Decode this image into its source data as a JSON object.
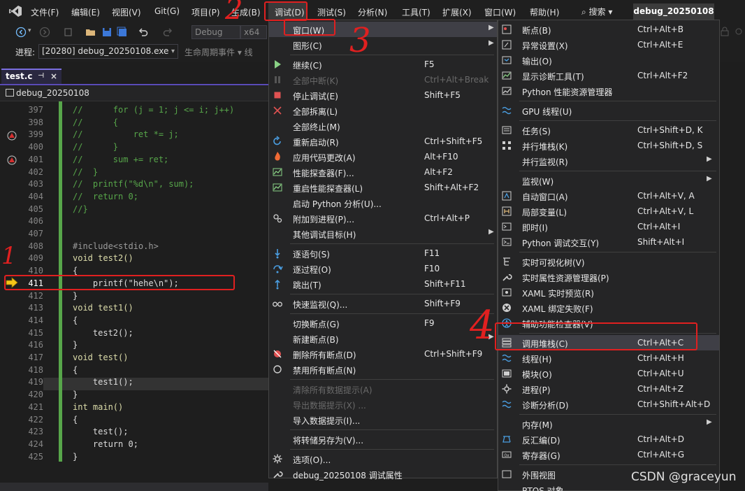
{
  "menubar": {
    "items": [
      "文件(F)",
      "编辑(E)",
      "视图(V)",
      "Git(G)",
      "项目(P)",
      "生成(B)",
      "调试(D)",
      "测试(S)",
      "分析(N)",
      "工具(T)",
      "扩展(X)",
      "窗口(W)",
      "帮助(H)"
    ],
    "search": "搜索",
    "solution": "debug_20250108"
  },
  "toolbar": {
    "config": "Debug",
    "platform": "x64",
    "process_label": "进程:",
    "process_value": "[20280] debug_20250108.exe",
    "lifecycle": "生命周期事件 ▾ 线"
  },
  "editor": {
    "tab_label": "test.c",
    "navbar_label": "debug_20250108",
    "lines": [
      {
        "n": "397",
        "t": "//      for (j = 1; j <= i; j++)",
        "c": "comment"
      },
      {
        "n": "398",
        "t": "//      {",
        "c": "comment"
      },
      {
        "n": "399",
        "t": "//          ret *= j;",
        "c": "comment"
      },
      {
        "n": "400",
        "t": "//      }",
        "c": "comment"
      },
      {
        "n": "401",
        "t": "//      sum += ret;",
        "c": "comment"
      },
      {
        "n": "402",
        "t": "//  }",
        "c": "comment"
      },
      {
        "n": "403",
        "t": "//  printf(\"%d\\n\", sum);",
        "c": "comment"
      },
      {
        "n": "404",
        "t": "//  return 0;",
        "c": "comment"
      },
      {
        "n": "405",
        "t": "//}",
        "c": "comment"
      },
      {
        "n": "406",
        "t": "",
        "c": "plain"
      },
      {
        "n": "407",
        "t": "",
        "c": "plain"
      },
      {
        "n": "408",
        "t": "#include<stdio.h>",
        "c": "pp"
      },
      {
        "n": "409",
        "t": "void test2()",
        "c": "decl"
      },
      {
        "n": "410",
        "t": "{",
        "c": "plain"
      },
      {
        "n": "411",
        "t": "    printf(\"hehe\\n\");",
        "c": "plain"
      },
      {
        "n": "412",
        "t": "}",
        "c": "plain"
      },
      {
        "n": "413",
        "t": "void test1()",
        "c": "decl"
      },
      {
        "n": "414",
        "t": "{",
        "c": "plain"
      },
      {
        "n": "415",
        "t": "    test2();",
        "c": "plain"
      },
      {
        "n": "416",
        "t": "}",
        "c": "plain"
      },
      {
        "n": "417",
        "t": "void test()",
        "c": "decl"
      },
      {
        "n": "418",
        "t": "{",
        "c": "plain"
      },
      {
        "n": "419",
        "t": "    test1();",
        "c": "plain"
      },
      {
        "n": "420",
        "t": "}",
        "c": "plain"
      },
      {
        "n": "421",
        "t": "int main()",
        "c": "decl"
      },
      {
        "n": "422",
        "t": "{",
        "c": "plain"
      },
      {
        "n": "423",
        "t": "    test();",
        "c": "plain"
      },
      {
        "n": "424",
        "t": "    return 0;",
        "c": "plain"
      },
      {
        "n": "425",
        "t": "}",
        "c": "plain"
      }
    ],
    "current_line": "411"
  },
  "debug_menu": {
    "items": [
      {
        "label": "窗口(W)",
        "shortcut": "",
        "icon": "",
        "submenu": true,
        "highlight": true
      },
      {
        "label": "图形(C)",
        "shortcut": "",
        "icon": "",
        "submenu": true
      },
      {
        "sep": true
      },
      {
        "label": "继续(C)",
        "shortcut": "F5",
        "icon": "play-icon"
      },
      {
        "label": "全部中断(K)",
        "shortcut": "Ctrl+Alt+Break",
        "icon": "pause-icon",
        "disabled": true
      },
      {
        "label": "停止调试(E)",
        "shortcut": "Shift+F5",
        "icon": "stop-icon"
      },
      {
        "label": "全部拆离(L)",
        "shortcut": "",
        "icon": "detach-icon"
      },
      {
        "label": "全部终止(M)",
        "shortcut": "",
        "icon": ""
      },
      {
        "label": "重新启动(R)",
        "shortcut": "Ctrl+Shift+F5",
        "icon": "restart-icon"
      },
      {
        "label": "应用代码更改(A)",
        "shortcut": "Alt+F10",
        "icon": "hot-reload-icon"
      },
      {
        "label": "性能探查器(F)...",
        "shortcut": "Alt+F2",
        "icon": "profiler-icon"
      },
      {
        "label": "重启性能探查器(L)",
        "shortcut": "Shift+Alt+F2",
        "icon": "profiler-restart-icon"
      },
      {
        "label": "启动 Python 分析(U)...",
        "shortcut": "",
        "icon": ""
      },
      {
        "label": "附加到进程(P)...",
        "shortcut": "Ctrl+Alt+P",
        "icon": "attach-icon"
      },
      {
        "label": "其他调试目标(H)",
        "shortcut": "",
        "icon": "",
        "submenu": true
      },
      {
        "sep": true
      },
      {
        "label": "逐语句(S)",
        "shortcut": "F11",
        "icon": "step-into-icon"
      },
      {
        "label": "逐过程(O)",
        "shortcut": "F10",
        "icon": "step-over-icon"
      },
      {
        "label": "跳出(T)",
        "shortcut": "Shift+F11",
        "icon": "step-out-icon"
      },
      {
        "sep": true
      },
      {
        "label": "快速监视(Q)...",
        "shortcut": "Shift+F9",
        "icon": "glasses-icon"
      },
      {
        "sep": true
      },
      {
        "label": "切换断点(G)",
        "shortcut": "F9",
        "icon": ""
      },
      {
        "label": "新建断点(B)",
        "shortcut": "",
        "icon": "",
        "submenu": true
      },
      {
        "label": "删除所有断点(D)",
        "shortcut": "Ctrl+Shift+F9",
        "icon": "delete-breakpoints-icon"
      },
      {
        "label": "禁用所有断点(N)",
        "shortcut": "",
        "icon": "disable-breakpoints-icon"
      },
      {
        "sep": true
      },
      {
        "label": "清除所有数据提示(A)",
        "shortcut": "",
        "icon": "",
        "disabled": true
      },
      {
        "label": "导出数据提示(X) ...",
        "shortcut": "",
        "icon": "",
        "disabled": true
      },
      {
        "label": "导入数据提示(I)...",
        "shortcut": "",
        "icon": ""
      },
      {
        "sep": true
      },
      {
        "label": "将转储另存为(V)...",
        "shortcut": "",
        "icon": ""
      },
      {
        "sep": true
      },
      {
        "label": "选项(O)...",
        "shortcut": "",
        "icon": "gear-icon"
      },
      {
        "label": "debug_20250108 调试属性",
        "shortcut": "",
        "icon": "wrench-icon"
      }
    ]
  },
  "window_submenu": {
    "items": [
      {
        "label": "断点(B)",
        "shortcut": "Ctrl+Alt+B",
        "icon": "breakpoints-icon"
      },
      {
        "label": "异常设置(X)",
        "shortcut": "Ctrl+Alt+E",
        "icon": "exception-icon"
      },
      {
        "label": "输出(O)",
        "shortcut": "",
        "icon": "output-icon"
      },
      {
        "label": "显示诊断工具(T)",
        "shortcut": "Ctrl+Alt+F2",
        "icon": "diagnostics-icon"
      },
      {
        "label": "Python 性能资源管理器",
        "shortcut": "",
        "icon": "python-perf-icon"
      },
      {
        "sep": true
      },
      {
        "label": "GPU 线程(U)",
        "shortcut": "",
        "icon": "gpu-threads-icon"
      },
      {
        "sep": true
      },
      {
        "label": "任务(S)",
        "shortcut": "Ctrl+Shift+D, K",
        "icon": "tasks-icon"
      },
      {
        "label": "并行堆栈(K)",
        "shortcut": "Ctrl+Shift+D, S",
        "icon": "parallel-stacks-icon"
      },
      {
        "label": "并行监视(R)",
        "shortcut": "",
        "icon": "",
        "submenu": true
      },
      {
        "sep": true
      },
      {
        "label": "监视(W)",
        "shortcut": "",
        "icon": "",
        "submenu": true
      },
      {
        "label": "自动窗口(A)",
        "shortcut": "Ctrl+Alt+V, A",
        "icon": "autos-icon"
      },
      {
        "label": "局部变量(L)",
        "shortcut": "Ctrl+Alt+V, L",
        "icon": "locals-icon"
      },
      {
        "label": "即时(I)",
        "shortcut": "Ctrl+Alt+I",
        "icon": "immediate-icon"
      },
      {
        "label": "Python 调试交互(Y)",
        "shortcut": "Shift+Alt+I",
        "icon": "python-interactive-icon"
      },
      {
        "sep": true
      },
      {
        "label": "实时可视化树(V)",
        "shortcut": "",
        "icon": "visual-tree-icon"
      },
      {
        "label": "实时属性资源管理器(P)",
        "shortcut": "",
        "icon": "property-explorer-icon"
      },
      {
        "label": "XAML 实时预览(R)",
        "shortcut": "",
        "icon": "xaml-preview-icon"
      },
      {
        "label": "XAML 绑定失败(F)",
        "shortcut": "",
        "icon": "binding-failure-icon"
      },
      {
        "label": "辅助功能检查器(V)",
        "shortcut": "",
        "icon": "accessibility-icon"
      },
      {
        "sep": true
      },
      {
        "label": "调用堆栈(C)",
        "shortcut": "Ctrl+Alt+C",
        "icon": "call-stack-icon",
        "highlight": true
      },
      {
        "label": "线程(H)",
        "shortcut": "Ctrl+Alt+H",
        "icon": "threads-icon"
      },
      {
        "label": "模块(O)",
        "shortcut": "Ctrl+Alt+U",
        "icon": "modules-icon"
      },
      {
        "label": "进程(P)",
        "shortcut": "Ctrl+Alt+Z",
        "icon": "processes-icon"
      },
      {
        "label": "诊断分析(D)",
        "shortcut": "Ctrl+Shift+Alt+D",
        "icon": "diagnostic-analysis-icon"
      },
      {
        "sep": true
      },
      {
        "label": "内存(M)",
        "shortcut": "",
        "icon": "",
        "submenu": true
      },
      {
        "label": "反汇编(D)",
        "shortcut": "Ctrl+Alt+D",
        "icon": "disassembly-icon"
      },
      {
        "label": "寄存器(G)",
        "shortcut": "Ctrl+Alt+G",
        "icon": "registers-icon"
      },
      {
        "sep": true
      },
      {
        "label": "外围视图",
        "shortcut": "",
        "icon": "peripheral-icon"
      },
      {
        "label": "RTOS 对象",
        "shortcut": "",
        "icon": ""
      }
    ]
  },
  "annotations": [
    "1",
    "2",
    "3",
    "4"
  ],
  "watermark": "CSDN @graceyun",
  "colors": {
    "accent": "#5a4bb8",
    "annotation": "#e02020",
    "comment": "#57a64a",
    "keyword": "#569cd6"
  }
}
